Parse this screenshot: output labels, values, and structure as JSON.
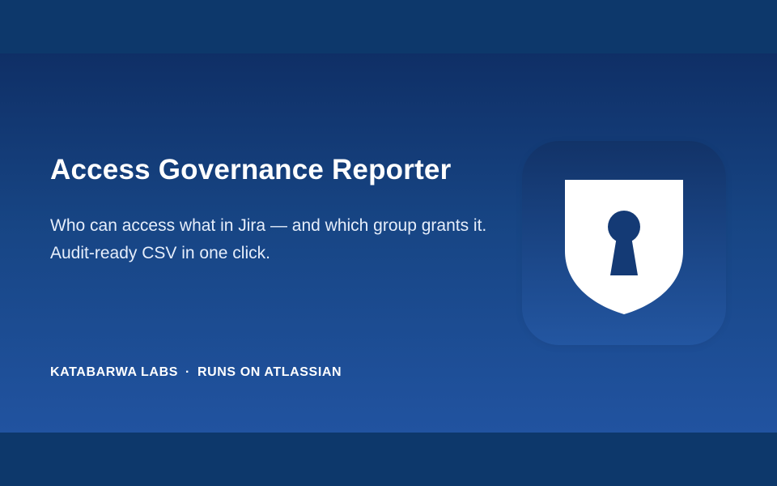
{
  "hero": {
    "title": "Access Governance Reporter",
    "tagline": "Who can access what in Jira — and which group grants it. Audit-ready CSV in one click.",
    "vendor": "KATABARWA LABS",
    "separator": "·",
    "platform": "RUNS ON ATLASSIAN"
  },
  "icon": {
    "name": "shield-keyhole-icon"
  },
  "colors": {
    "page_band_top": "#0d386b",
    "gradient_top": "#0f2f66",
    "gradient_bottom": "#2153a0",
    "text": "#ffffff",
    "keyhole": "#143a75"
  }
}
